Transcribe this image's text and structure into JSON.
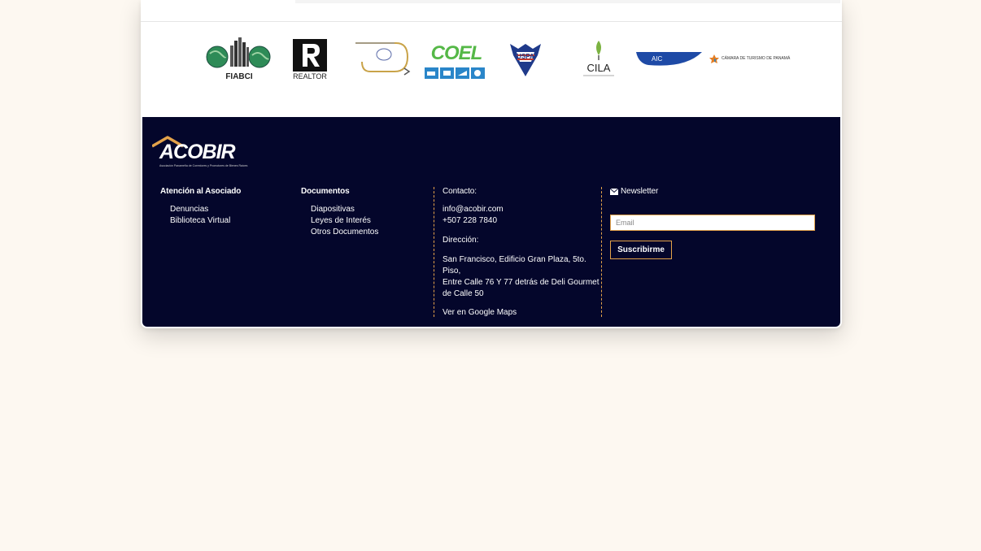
{
  "partners": {
    "fiabci": "FIABCI",
    "realtor": "REALTOR",
    "coel": "COEL",
    "uspa": "USPA",
    "cila": "CILA",
    "aic": "AIC",
    "camara": "CÁMARA DE TURISMO DE PANAMÁ"
  },
  "footer": {
    "logo_text": "ACOBIR",
    "logo_tagline": "Asociación Panameña de Corredores y Promotores de Bienes Raíces",
    "col1": {
      "heading": "Atención al Asociado",
      "links": [
        "Denuncias",
        "Biblioteca Virtual"
      ]
    },
    "col2": {
      "heading": "Documentos",
      "links": [
        "Diapositivas",
        "Leyes de Interés",
        "Otros Documentos"
      ]
    },
    "contact": {
      "heading": "Contacto:",
      "email": "info@acobir.com",
      "phone": "+507 228 7840",
      "address_heading": "Dirección:",
      "address_lines": [
        "San Francisco, Edificio Gran Plaza, 5to. Piso,",
        "Entre Calle 76 Y 77 detrás de Deli Gourmet",
        "de Calle 50"
      ],
      "maps_link": "Ver en Google Maps"
    },
    "newsletter": {
      "heading": "Newsletter",
      "email_placeholder": "Email",
      "subscribe_label": "Suscribirme"
    }
  },
  "colors": {
    "footer_bg": "#04062b",
    "accent": "#e3a24a",
    "page_bg": "#fdf8f1"
  }
}
